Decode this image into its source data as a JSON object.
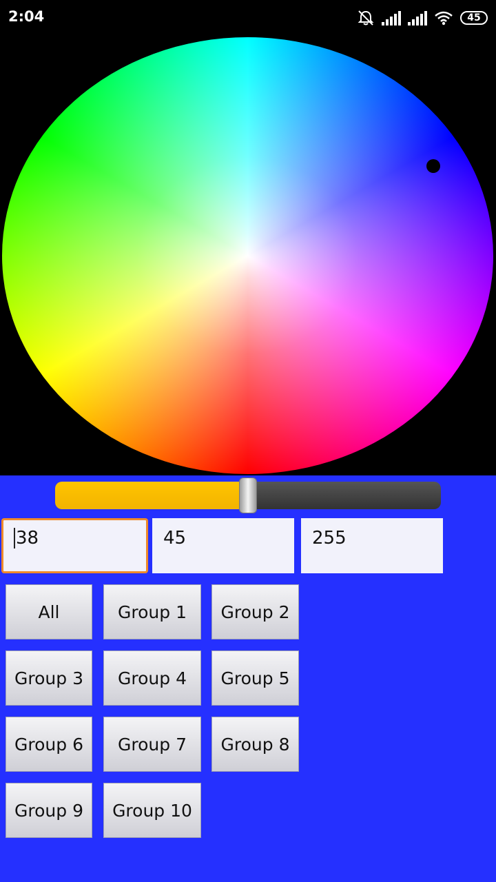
{
  "status_bar": {
    "time": "2:04",
    "battery_level": "45",
    "icons": [
      "notifications-off-icon",
      "signal-icon",
      "signal-icon",
      "wifi-icon",
      "battery-icon"
    ]
  },
  "color_wheel": {
    "selected_color": "#0000ff"
  },
  "brightness_slider": {
    "value_fraction": 0.5,
    "fill_color": "#ffc400",
    "track_color": "#3d3d3d"
  },
  "rgb_inputs": [
    {
      "value": "38"
    },
    {
      "value": "45"
    },
    {
      "value": "255"
    }
  ],
  "group_buttons": [
    {
      "label": "All"
    },
    {
      "label": "Group 1"
    },
    {
      "label": "Group 2"
    },
    {
      "label": "Group 3"
    },
    {
      "label": "Group 4"
    },
    {
      "label": "Group 5"
    },
    {
      "label": "Group 6"
    },
    {
      "label": "Group 7"
    },
    {
      "label": "Group 8"
    },
    {
      "label": "Group 9"
    },
    {
      "label": "Group 10"
    }
  ],
  "colors": {
    "background": "#2530ff",
    "focus_border": "#ef8a2a"
  }
}
